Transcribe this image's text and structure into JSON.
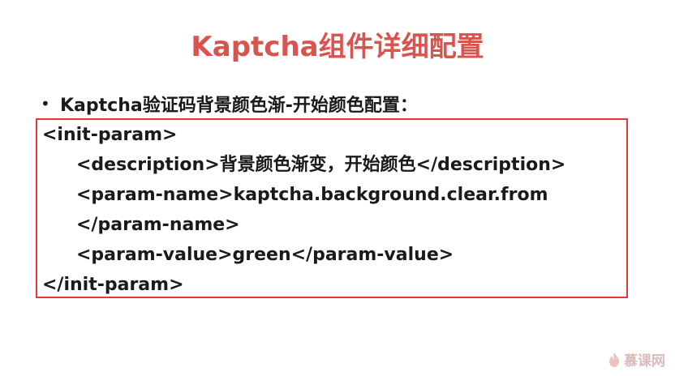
{
  "slide": {
    "title": "Kaptcha组件详细配置",
    "bullet": "•",
    "bullet_text": "Kaptcha验证码背景颜色渐-开始颜色配置：",
    "code_lines": [
      "<init-param>",
      "<description>背景颜色渐变，开始颜色</description>",
      "<param-name>kaptcha.background.clear.from",
      "</param-name>",
      "<param-value>green</param-value>",
      "</init-param>"
    ],
    "watermark": "慕课网"
  },
  "colors": {
    "title": "#d9534f",
    "box_border": "#e53935",
    "watermark": "#d8b3b3"
  },
  "icons": {
    "watermark_logo": "flame-icon"
  }
}
